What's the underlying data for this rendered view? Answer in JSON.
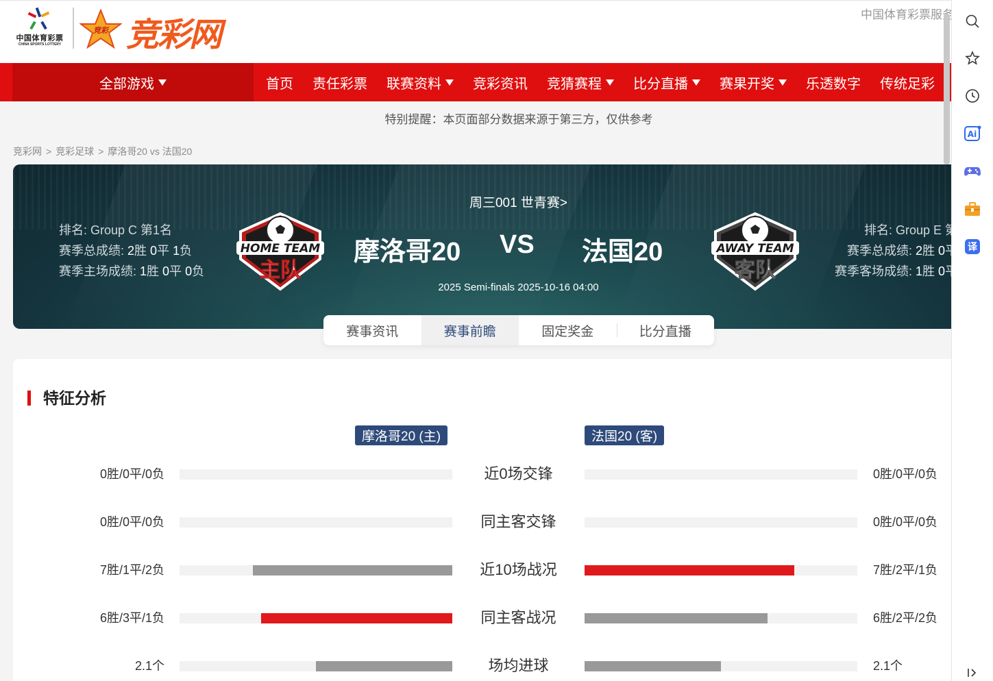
{
  "header": {
    "lottery_logo_cn": "中国体育彩票",
    "lottery_logo_en": "CHINA SPORTS LOTTERY",
    "site_logo_text": "竞彩网",
    "site_logo_badge": "竞彩",
    "top_service": "中国体育彩票服务"
  },
  "nav": {
    "all_games": "全部游戏",
    "items": [
      {
        "label": "首页",
        "dropdown": false
      },
      {
        "label": "责任彩票",
        "dropdown": false
      },
      {
        "label": "联赛资料",
        "dropdown": true
      },
      {
        "label": "竞彩资讯",
        "dropdown": false
      },
      {
        "label": "竞猜赛程",
        "dropdown": true
      },
      {
        "label": "比分直播",
        "dropdown": true
      },
      {
        "label": "赛果开奖",
        "dropdown": true
      },
      {
        "label": "乐透数字",
        "dropdown": false
      },
      {
        "label": "传统足彩",
        "dropdown": false
      }
    ]
  },
  "notice": "特别提醒：本页面部分数据来源于第三方，仅供参考",
  "breadcrumb": [
    "竞彩网",
    "竞彩足球",
    "摩洛哥20 vs 法国20"
  ],
  "match": {
    "league_link": "周三001 世青赛>",
    "home": {
      "name": "摩洛哥20",
      "logo_top": "HOME TEAM",
      "logo_bottom": "主队",
      "rank_label": "排名: ",
      "rank_value": "Group C 第1名",
      "season_label": "赛季总成绩: ",
      "season_w": "2",
      "season_d": "0",
      "season_l": "1",
      "venue_label": "赛季主场成绩: ",
      "venue_w": "1",
      "venue_d": "0",
      "venue_l": "0"
    },
    "away": {
      "name": "法国20",
      "logo_top": "AWAY TEAM",
      "logo_bottom": "客队",
      "rank_label": "排名: ",
      "rank_value": "Group E 第",
      "season_label": "赛季总成绩: ",
      "season_w": "2",
      "season_d": "0",
      "venue_label": "赛季客场成绩: ",
      "venue_w": "1",
      "venue_d": "0"
    },
    "vs": "VS",
    "meta": "2025 Semi-finals 2025-10-16 04:00",
    "unit_win": "胜",
    "unit_draw": "平",
    "unit_loss": "负"
  },
  "tabs": [
    {
      "label": "赛事资讯",
      "active": false
    },
    {
      "label": "赛事前瞻",
      "active": true
    },
    {
      "label": "固定奖金",
      "active": false
    },
    {
      "label": "比分直播",
      "active": false
    }
  ],
  "analysis": {
    "title": "特征分析",
    "home_tag": "摩洛哥20 (主)",
    "away_tag": "法国20 (客)",
    "rows": [
      {
        "label": "近0场交锋",
        "home_value": "0胜/0平/0负",
        "away_value": "0胜/0平/0负",
        "home_fill": 0,
        "away_fill": 0,
        "home_color": "gray",
        "away_color": "gray"
      },
      {
        "label": "同主客交锋",
        "home_value": "0胜/0平/0负",
        "away_value": "0胜/0平/0负",
        "home_fill": 0,
        "away_fill": 0,
        "home_color": "gray",
        "away_color": "gray"
      },
      {
        "label": "近10场战况",
        "home_value": "7胜/1平/2负",
        "away_value": "7胜/2平/1负",
        "home_fill": 0.73,
        "away_fill": 0.77,
        "home_color": "gray",
        "away_color": "red"
      },
      {
        "label": "同主客战况",
        "home_value": "6胜/3平/1负",
        "away_value": "6胜/2平/2负",
        "home_fill": 0.7,
        "away_fill": 0.67,
        "home_color": "red",
        "away_color": "gray"
      },
      {
        "label": "场均进球",
        "home_value": "2.1个",
        "away_value": "2.1个",
        "home_fill": 0.5,
        "away_fill": 0.5,
        "home_color": "gray",
        "away_color": "gray"
      }
    ]
  },
  "sidebar": {
    "icons": [
      "search-icon",
      "star-icon",
      "history-icon",
      "ai-icon",
      "game-icon",
      "toolbox-icon",
      "translate-icon",
      "collapse-icon"
    ],
    "ai_text": "Ai",
    "translate_text": "译"
  }
}
